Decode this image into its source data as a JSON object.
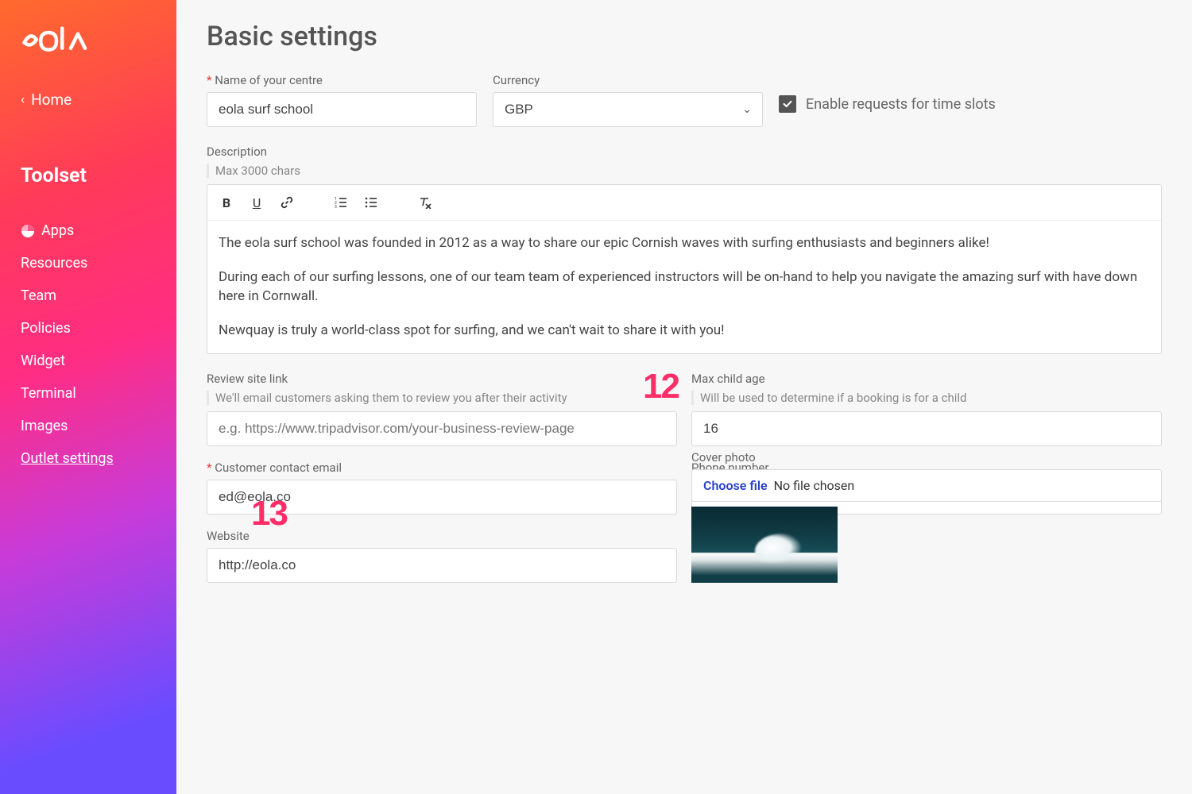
{
  "brand": "eola",
  "sidebar": {
    "home": "Home",
    "section": "Toolset",
    "items": [
      {
        "label": "Apps",
        "icon": "apps"
      },
      {
        "label": "Resources"
      },
      {
        "label": "Team"
      },
      {
        "label": "Policies"
      },
      {
        "label": "Widget"
      },
      {
        "label": "Terminal"
      },
      {
        "label": "Images"
      },
      {
        "label": "Outlet settings",
        "active": true
      }
    ]
  },
  "page": {
    "title": "Basic settings",
    "nameLabel": "Name of your centre",
    "nameValue": "eola surf school",
    "currencyLabel": "Currency",
    "currencyValue": "GBP",
    "enableRequests": "Enable requests for time slots",
    "descLabel": "Description",
    "descHint": "Max 3000 chars",
    "descP1": "The eola surf school was founded in 2012 as a way to share our epic Cornish waves with surfing enthusiasts and beginners alike!",
    "descP2": "During each of our surfing lessons, one of our team team of experienced instructors will be on-hand to help you navigate the amazing surf with have down here in Cornwall.",
    "descP3": "Newquay is truly a world-class spot for surfing, and we can't wait to share it with you!",
    "reviewLabel": "Review site link",
    "reviewHint": "We'll email customers asking them to review you after their activity",
    "reviewPlaceholder": "e.g. https://www.tripadvisor.com/your-business-review-page",
    "childLabel": "Max child age",
    "childHint": "Will be used to determine if a booking is for a child",
    "childValue": "16",
    "emailLabel": "Customer contact email",
    "emailValue": "ed@eola.co",
    "phoneLabel": "Phone number",
    "phoneValue": "",
    "coverLabel": "Cover photo",
    "chooseFile": "Choose file",
    "noFile": "No file chosen",
    "websiteLabel": "Website",
    "websiteValue": "http://eola.co"
  },
  "annotations": {
    "a12": "12",
    "a13": "13"
  }
}
